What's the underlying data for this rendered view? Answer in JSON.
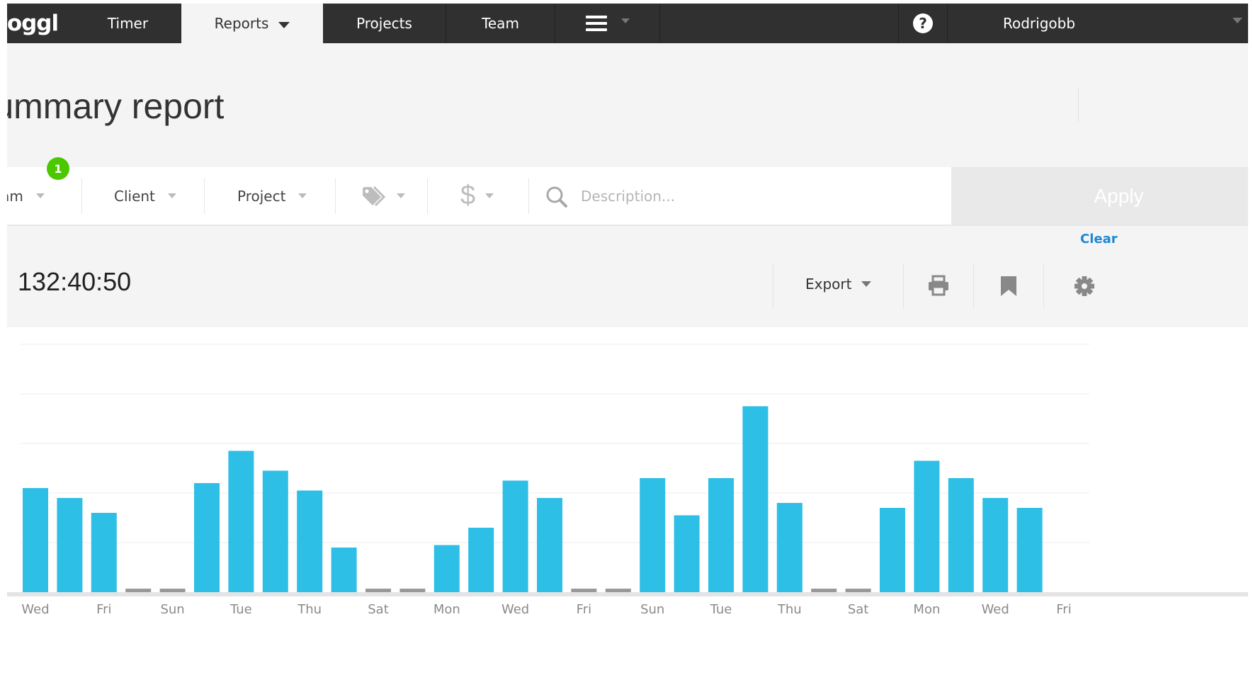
{
  "nav": {
    "logo": "toggl",
    "timer": "Timer",
    "reports": "Reports",
    "projects": "Projects",
    "team": "Team",
    "user": "Rodrigobb"
  },
  "header": {
    "title": "Summary report"
  },
  "filters": {
    "badge": "1",
    "team": "Team",
    "client": "Client",
    "project": "Project",
    "search_placeholder": "Description...",
    "apply": "Apply",
    "clear": "Clear"
  },
  "summary": {
    "total": "132:40:50",
    "export": "Export"
  },
  "icons": {
    "help": "help-circle-icon",
    "menu": "hamburger-menu-icon",
    "tag": "tag-icon",
    "dollar": "dollar-icon",
    "search": "search-icon",
    "print": "printer-icon",
    "bookmark": "bookmark-icon",
    "settings": "gear-icon"
  },
  "colors": {
    "nav_bg": "#303030",
    "bar": "#2dbfe5",
    "empty_bar": "#999999",
    "badge": "#4bc800",
    "link": "#1e88d6"
  },
  "chart_data": {
    "type": "bar",
    "x": [
      "Wed",
      "Thu",
      "Fri",
      "Sat",
      "Sun",
      "Mon",
      "Tue",
      "Wed",
      "Thu",
      "Fri",
      "Sat",
      "Sun",
      "Mon",
      "Tue",
      "Wed",
      "Thu",
      "Fri",
      "Sat",
      "Sun",
      "Mon",
      "Tue",
      "Wed",
      "Thu",
      "Fri",
      "Sat",
      "Sun",
      "Mon",
      "Tue",
      "Wed",
      "Thu",
      "Fri"
    ],
    "tick_labels": [
      "Wed",
      "Fri",
      "Sun",
      "Tue",
      "Thu",
      "Sat",
      "Mon",
      "Wed",
      "Fri",
      "Sun",
      "Tue",
      "Thu",
      "Sat",
      "Mon",
      "Wed",
      "Fri"
    ],
    "values": [
      2.1,
      1.9,
      1.6,
      0,
      0,
      2.2,
      2.85,
      2.45,
      2.05,
      0.9,
      0,
      0,
      0.95,
      1.3,
      2.25,
      1.9,
      0,
      0,
      2.3,
      1.55,
      2.3,
      3.75,
      1.8,
      0,
      0,
      1.7,
      2.65,
      2.3,
      1.9,
      1.7
    ],
    "ylim": [
      0,
      5
    ],
    "grid": true
  }
}
